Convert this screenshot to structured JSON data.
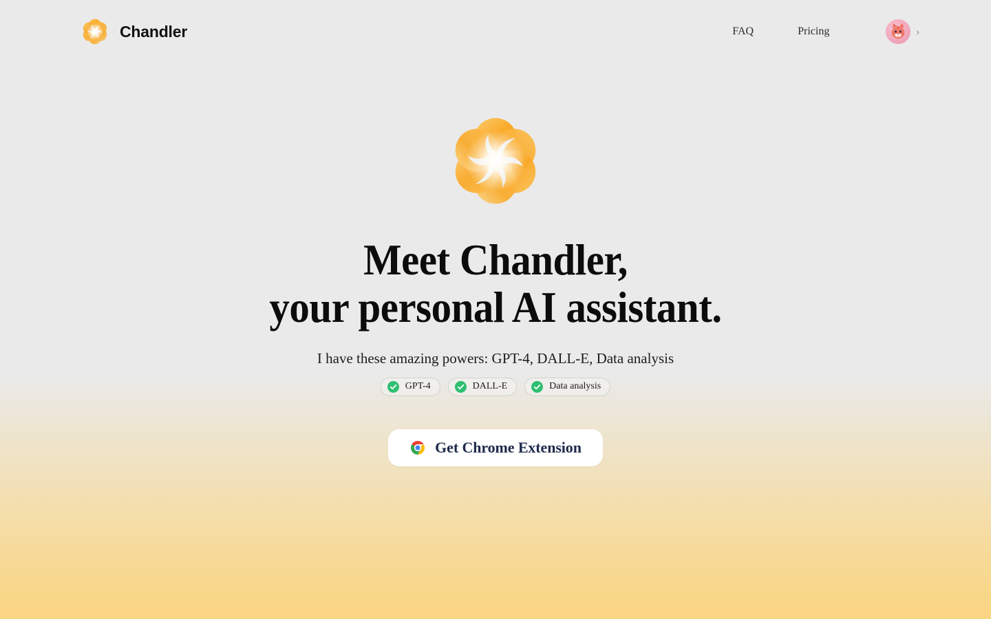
{
  "brand": {
    "name": "Chandler",
    "logo_icon": "chandler-flower-logo"
  },
  "header": {
    "nav_links": [
      {
        "label": "FAQ"
      },
      {
        "label": "Pricing"
      }
    ],
    "account": {
      "avatar_icon": "cat-avatar",
      "chevron_icon": "chevron-right-icon",
      "chevron_glyph": "›"
    }
  },
  "hero": {
    "logo_icon": "chandler-flower-logo-large",
    "headline_line1": "Meet Chandler,",
    "headline_line2": "your personal AI assistant.",
    "subtitle": "I have these amazing powers: GPT-4, DALL-E, Data analysis",
    "powers": [
      {
        "label": "GPT-4",
        "icon": "check-circle-icon"
      },
      {
        "label": "DALL-E",
        "icon": "check-circle-icon"
      },
      {
        "label": "Data analysis",
        "icon": "check-circle-icon"
      }
    ],
    "cta": {
      "label": "Get Chrome Extension",
      "icon": "chrome-icon"
    }
  },
  "colors": {
    "page_background": "#eaeaea",
    "gradient_bottom": "#fad684",
    "brand_orange": "#f9a825",
    "check_green": "#2fbf71",
    "cta_text": "#1e2a4a",
    "avatar_pink": "#f0a6bb"
  }
}
